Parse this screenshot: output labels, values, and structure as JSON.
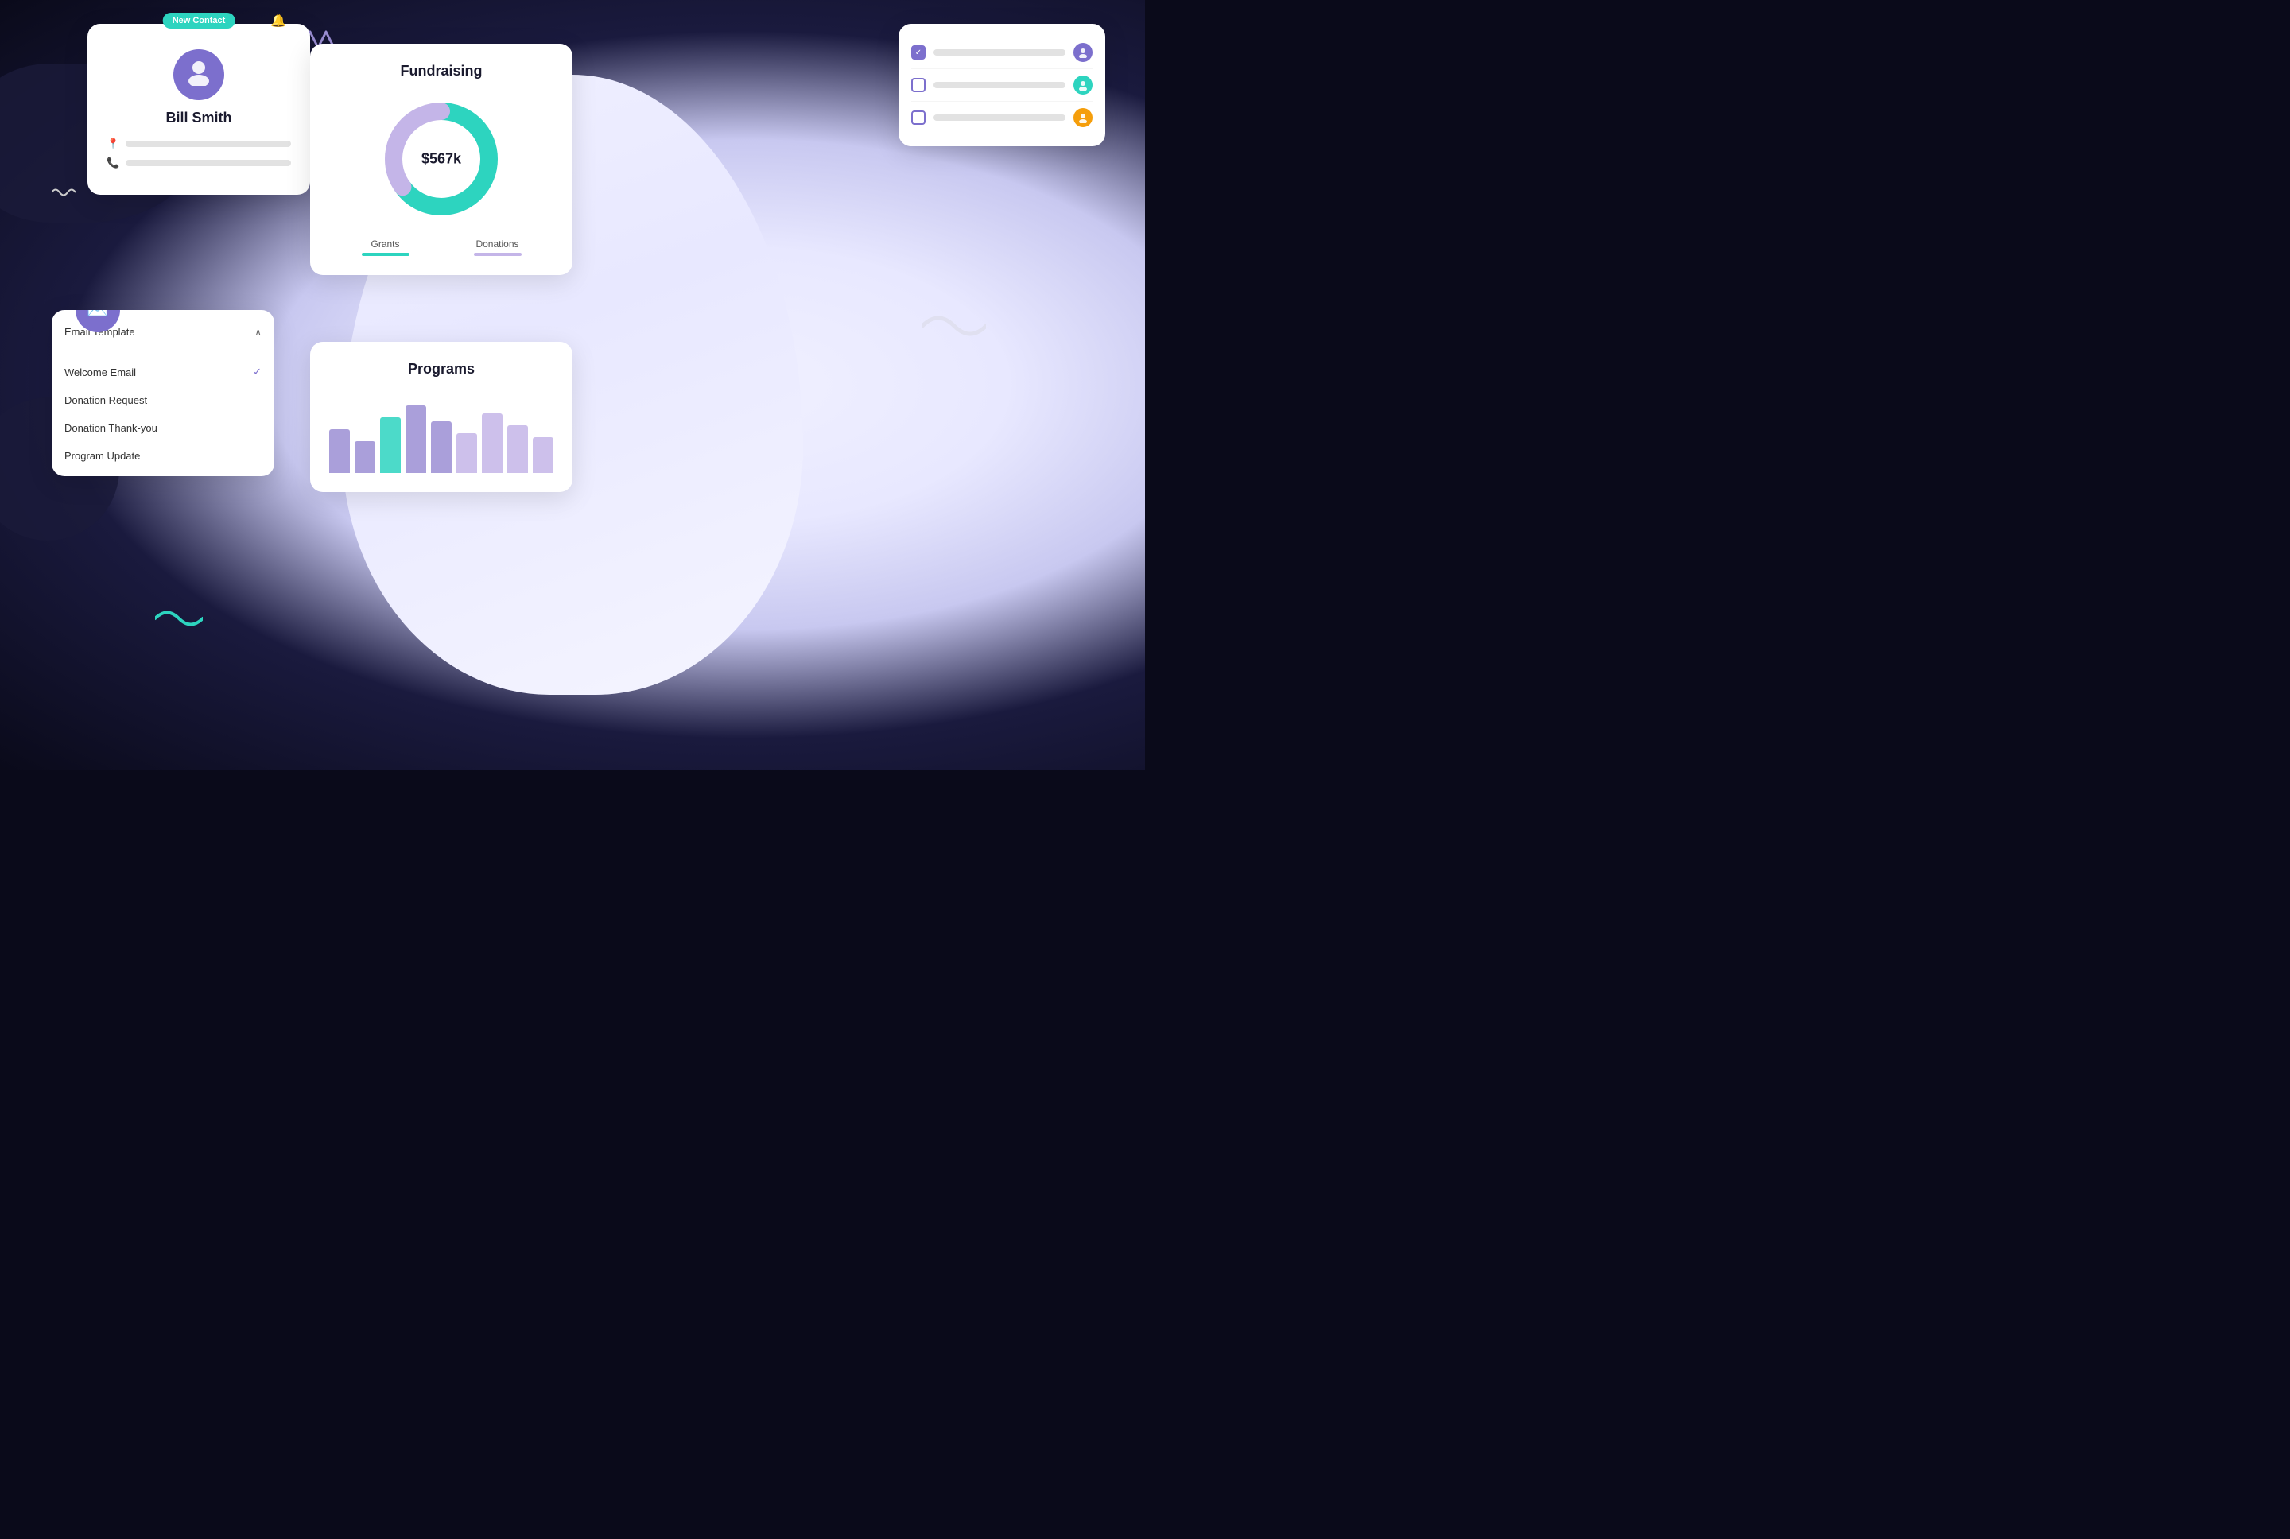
{
  "scene": {
    "background": "#0a0a1a"
  },
  "contact_card": {
    "badge": "New Contact",
    "name": "Bill Smith",
    "avatar_bg": "#7c6fcd"
  },
  "email_card": {
    "dropdown_label": "Email Template",
    "items": [
      {
        "label": "Welcome Email",
        "selected": true
      },
      {
        "label": "Donation Request",
        "selected": false
      },
      {
        "label": "Donation Thank-you",
        "selected": false
      },
      {
        "label": "Program Update",
        "selected": false
      }
    ]
  },
  "fundraising_card": {
    "title": "Fundraising",
    "amount": "$567k",
    "grants_label": "Grants",
    "donations_label": "Donations",
    "donut": {
      "grants_pct": 65,
      "donations_pct": 35,
      "grants_color": "#2dd4bf",
      "donations_color": "#c4b5e8"
    }
  },
  "programs_card": {
    "title": "Programs",
    "bars": [
      {
        "height": 55,
        "color": "#9b8ed4"
      },
      {
        "height": 40,
        "color": "#9b8ed4"
      },
      {
        "height": 70,
        "color": "#2dd4bf"
      },
      {
        "height": 85,
        "color": "#9b8ed4"
      },
      {
        "height": 65,
        "color": "#9b8ed4"
      },
      {
        "height": 50,
        "color": "#c4b5e8"
      },
      {
        "height": 75,
        "color": "#c4b5e8"
      },
      {
        "height": 60,
        "color": "#c4b5e8"
      },
      {
        "height": 45,
        "color": "#c4b5e8"
      }
    ]
  },
  "tasks_card": {
    "rows": [
      {
        "checked": true,
        "avatar_color": "#7c6fcd"
      },
      {
        "checked": false,
        "avatar_color": "#2dd4bf"
      },
      {
        "checked": false,
        "avatar_color": "#f59e0b"
      }
    ]
  }
}
